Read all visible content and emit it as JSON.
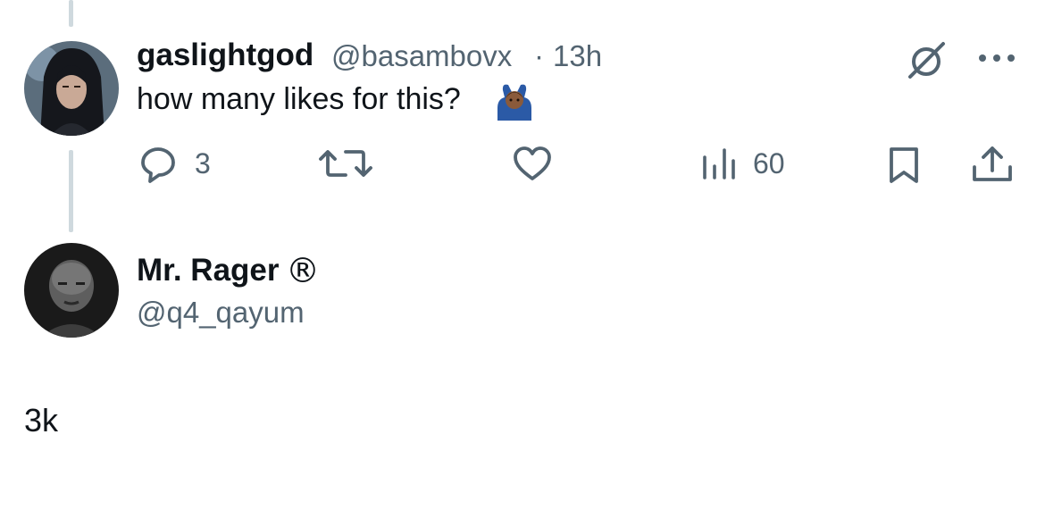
{
  "tweet": {
    "display_name": "gaslightgod",
    "handle": "@basambovx",
    "separator": "·",
    "time": "13h",
    "text": "how many likes for this?",
    "emoji_icon": "person-gesturing-ok-emoji",
    "actions": {
      "reply_count": "3",
      "retweet_count": "",
      "like_count": "",
      "views_count": "60"
    }
  },
  "reply": {
    "display_name": "Mr. Rager",
    "badge": "®",
    "handle": "@q4_qayum",
    "text": "3k"
  },
  "colors": {
    "text": "#0f1419",
    "muted": "#536471",
    "thread_line": "#cfd9de",
    "emoji_shirt": "#2b5aa6",
    "emoji_skin": "#8a5a3b"
  }
}
